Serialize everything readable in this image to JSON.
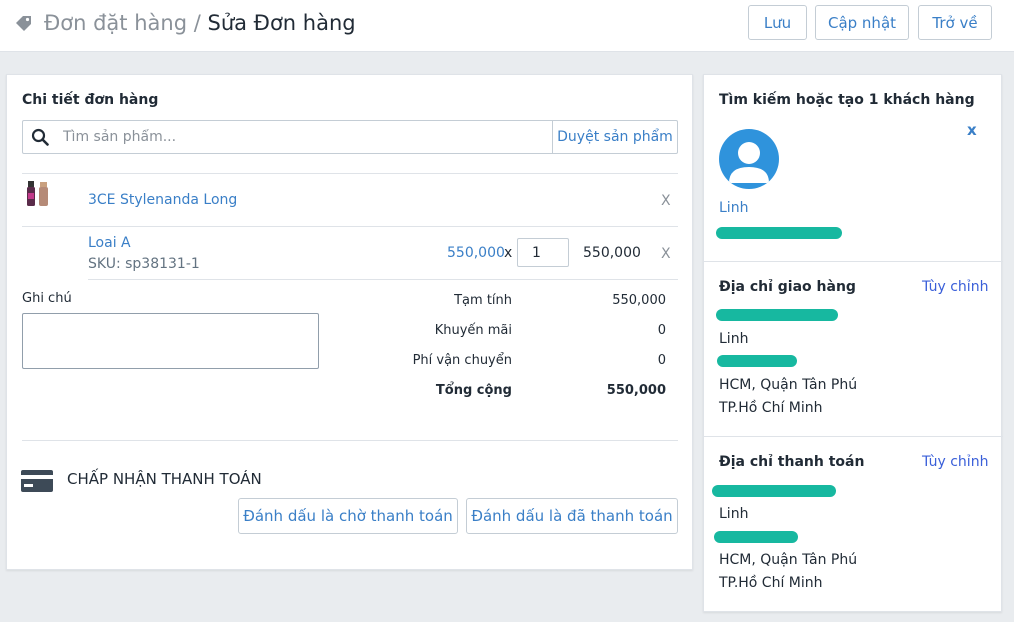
{
  "header": {
    "breadcrumb_parent": "Đơn đặt hàng",
    "breadcrumb_sep": "/",
    "breadcrumb_current": "Sửa Đơn hàng",
    "save_label": "Lưu",
    "update_label": "Cập nhật",
    "back_label": "Trở về"
  },
  "order": {
    "title": "Chi tiết đơn hàng",
    "search_placeholder": "Tìm sản phẩm...",
    "browse_label": "Duyệt sản phẩm",
    "product_name": "3CE Stylenanda Long",
    "remove_product": "X",
    "variant_name": "Loai A",
    "sku": "SKU: sp38131-1",
    "unit_price": "550,000",
    "times": "x",
    "quantity": "1",
    "line_total": "550,000",
    "remove_variant": "X",
    "note_label": "Ghi chú",
    "note_value": ""
  },
  "summary": {
    "subtotal_label": "Tạm tính",
    "subtotal": "550,000",
    "discount_label": "Khuyến mãi",
    "discount": "0",
    "shipping_label": "Phí vận chuyển",
    "shipping": "0",
    "total_label": "Tổng cộng",
    "total": "550,000"
  },
  "payment": {
    "title": "CHẤP NHẬN THANH TOÁN",
    "mark_pending": "Đánh dấu là chờ thanh toán",
    "mark_paid": "Đánh dấu là đã thanh toán"
  },
  "customer": {
    "title": "Tìm kiếm hoặc tạo 1 khách hàng",
    "close": "x",
    "name": "Linh"
  },
  "shipping_address": {
    "title": "Địa chỉ giao hàng",
    "customize": "Tùy chỉnh",
    "name": "Linh",
    "line1": "HCM, Quận Tân Phú",
    "line2": "TP.Hồ Chí Minh"
  },
  "billing_address": {
    "title": "Địa chỉ thanh toán",
    "customize": "Tùy chỉnh",
    "name": "Linh",
    "line1": "HCM, Quận Tân Phú",
    "line2": "TP.Hồ Chí Minh"
  },
  "colors": {
    "link": "#3a7fc7",
    "redaction": "#17b8a0",
    "avatar": "#2f93dc"
  },
  "icons": [
    "tag-icon",
    "search-icon",
    "credit-card-icon",
    "avatar-icon",
    "product-thumbnail"
  ]
}
